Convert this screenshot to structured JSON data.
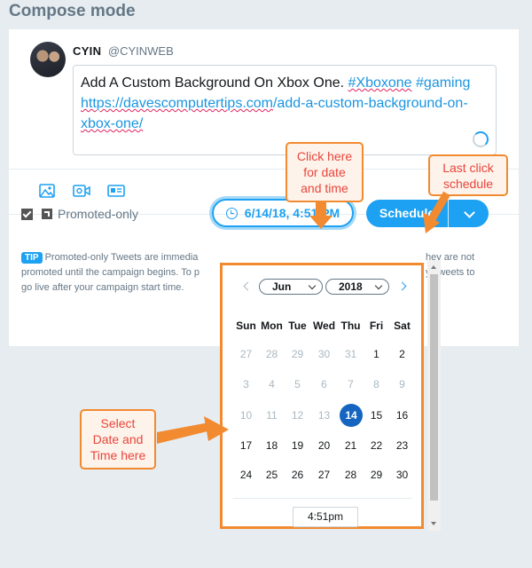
{
  "page": {
    "title": "Compose mode"
  },
  "user": {
    "name": "CYIN",
    "handle": "@CYINWEB"
  },
  "tweet": {
    "line1_prefix": "Add A Custom Background On Xbox One. ",
    "hashtag1": "#Xboxone",
    "hashtag2": "#gaming",
    "link_part1": "https://davescomputertips.com",
    "link_part2": "/add-a-custom-background-on-",
    "link_part3": "xbox-one/"
  },
  "media_icons": [
    "image-icon",
    "video-icon",
    "card-icon"
  ],
  "promoted": {
    "label": "Promoted-only",
    "checked": true
  },
  "schedule": {
    "datetime_label": "6/14/18, 4:51 PM",
    "button_label": "Schedule"
  },
  "tip": {
    "badge": "TIP",
    "left_l1": "Promoted-only Tweets are immedia",
    "left_l2": "promoted until the campaign begins. To p",
    "left_l3": "go live after your campaign start time.",
    "right_l1": "hey are not",
    "right_l2": "y Tweets to"
  },
  "calendar": {
    "month": "Jun",
    "year": "2018",
    "weekdays": [
      "Sun",
      "Mon",
      "Tue",
      "Wed",
      "Thu",
      "Fri",
      "Sat"
    ],
    "weeks": [
      [
        "27",
        "28",
        "29",
        "30",
        "31",
        "1",
        "2"
      ],
      [
        "3",
        "4",
        "5",
        "6",
        "7",
        "8",
        "9"
      ],
      [
        "10",
        "11",
        "12",
        "13",
        "14",
        "15",
        "16"
      ],
      [
        "17",
        "18",
        "19",
        "20",
        "21",
        "22",
        "23"
      ],
      [
        "24",
        "25",
        "26",
        "27",
        "28",
        "29",
        "30"
      ]
    ],
    "selected_day": "14",
    "time": "4:51pm"
  },
  "annotations": {
    "click_here": [
      "Click here",
      "for date",
      "and time"
    ],
    "last_click": [
      "Last click",
      "schedule"
    ],
    "select_date": [
      "Select",
      "Date and",
      "Time here"
    ]
  },
  "colors": {
    "accent": "#1da1f2",
    "annotation_orange": "#f28a30",
    "annotation_text": "#e8453c",
    "selected_day": "#1565c0"
  }
}
